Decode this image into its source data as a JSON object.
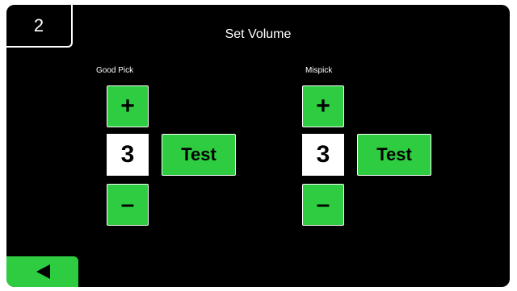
{
  "header": {
    "step_number": "2",
    "title": "Set Volume"
  },
  "good_pick": {
    "label": "Good Pick",
    "increase_symbol": "+",
    "value": "3",
    "decrease_symbol": "–",
    "test_label": "Test"
  },
  "mispick": {
    "label": "Mispick",
    "increase_symbol": "+",
    "value": "3",
    "decrease_symbol": "–",
    "test_label": "Test"
  },
  "footer": {
    "back_icon": "triangle-left-icon"
  },
  "colors": {
    "background": "#000000",
    "accent_green": "#2ecc40",
    "text": "#ffffff"
  }
}
